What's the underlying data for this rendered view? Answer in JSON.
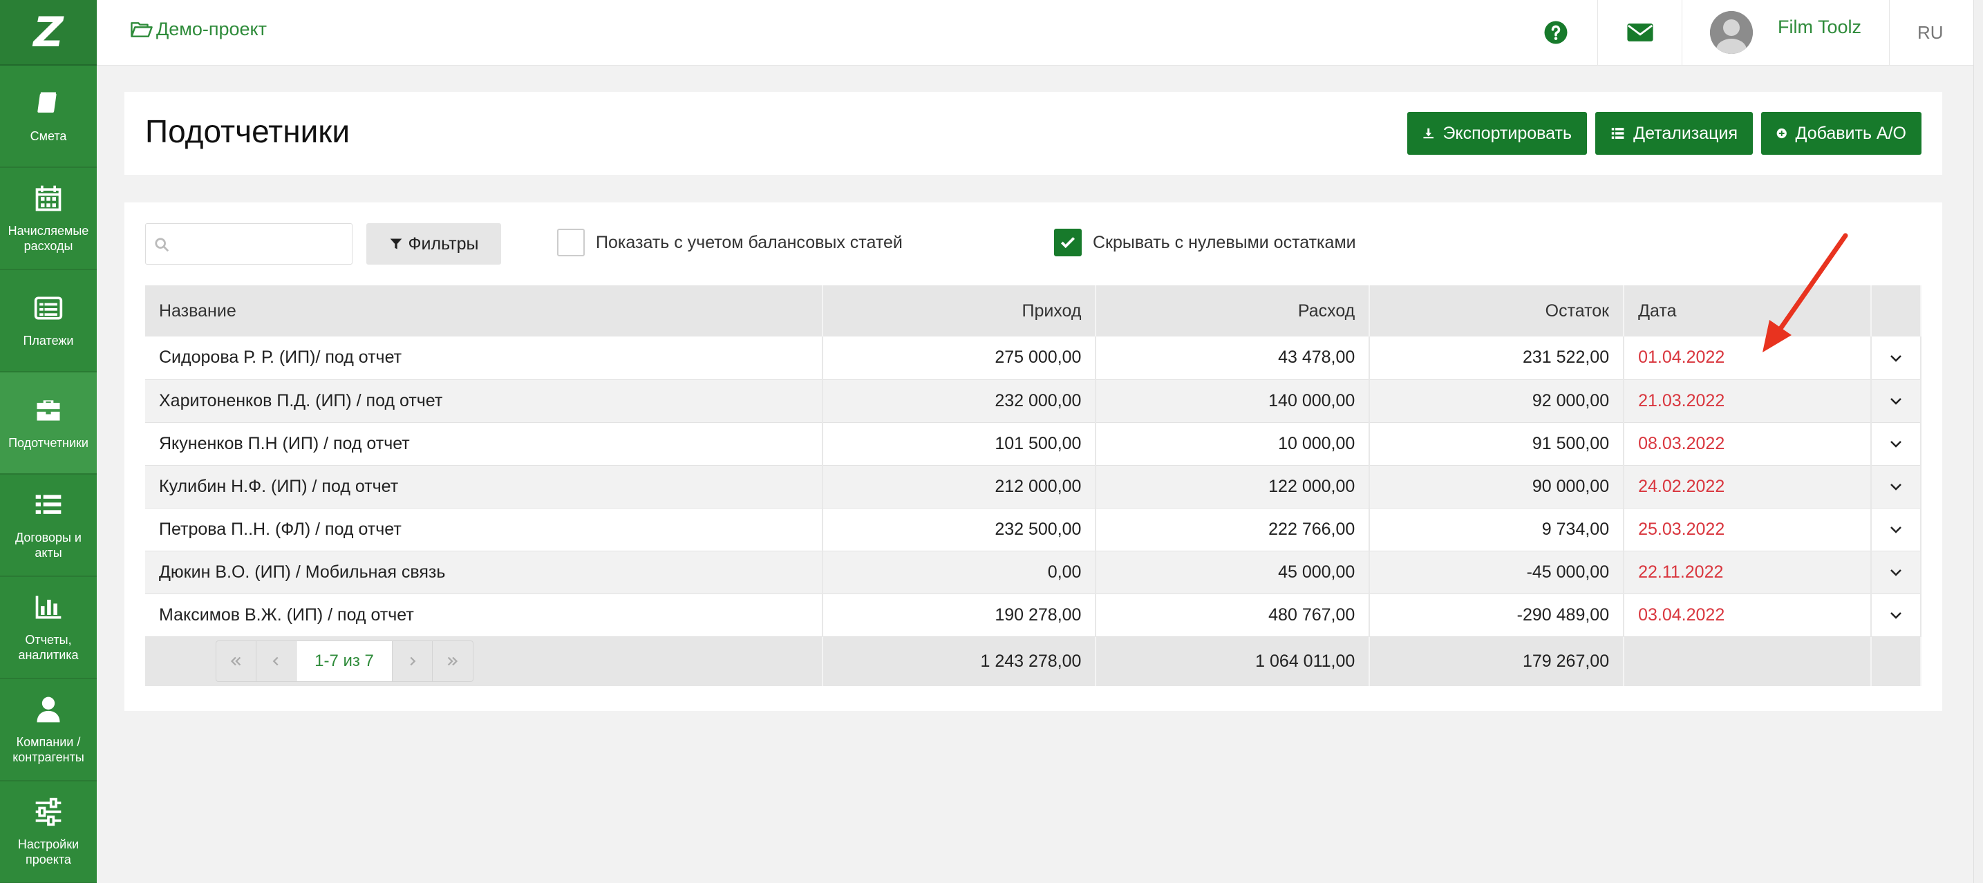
{
  "sidebar": {
    "logo": "Z",
    "items": [
      {
        "label": "Смета",
        "icon": "book-icon"
      },
      {
        "label": "Начисляемые расходы",
        "icon": "calendar-icon"
      },
      {
        "label": "Платежи",
        "icon": "list-window-icon"
      },
      {
        "label": "Подотчетники",
        "icon": "briefcase-icon",
        "active": true
      },
      {
        "label": "Договоры и акты",
        "icon": "list-icon"
      },
      {
        "label": "Отчеты, аналитика",
        "icon": "bar-chart-icon"
      },
      {
        "label": "Компании / контрагенты",
        "icon": "user-icon"
      },
      {
        "label": "Настройки проекта",
        "icon": "sliders-icon"
      }
    ]
  },
  "topbar": {
    "breadcrumb": "Демо-проект",
    "user_name": "Film Toolz",
    "language": "RU"
  },
  "page": {
    "title": "Подотчетники",
    "buttons": {
      "export": "Экспортировать",
      "details": "Детализация",
      "add": "Добавить А/О"
    }
  },
  "filters": {
    "search_value": "",
    "filter_button": "Фильтры",
    "checkbox_balance": {
      "label": "Показать с учетом балансовых статей",
      "checked": false
    },
    "checkbox_zero": {
      "label": "Скрывать с нулевыми остатками",
      "checked": true
    }
  },
  "table": {
    "columns": [
      "Название",
      "Приход",
      "Расход",
      "Остаток",
      "Дата"
    ],
    "rows": [
      {
        "name": "Сидорова Р. Р. (ИП)/ под отчет",
        "income": "275 000,00",
        "expense": "43 478,00",
        "balance": "231 522,00",
        "date": "01.04.2022"
      },
      {
        "name": "Харитоненков П.Д. (ИП) / под отчет",
        "income": "232 000,00",
        "expense": "140 000,00",
        "balance": "92 000,00",
        "date": "21.03.2022"
      },
      {
        "name": "Якуненков П.Н (ИП) / под отчет",
        "income": "101 500,00",
        "expense": "10 000,00",
        "balance": "91 500,00",
        "date": "08.03.2022"
      },
      {
        "name": "Кулибин Н.Ф. (ИП) / под отчет",
        "income": "212 000,00",
        "expense": "122 000,00",
        "balance": "90 000,00",
        "date": "24.02.2022"
      },
      {
        "name": "Петрова П..Н. (ФЛ) / под отчет",
        "income": "232 500,00",
        "expense": "222 766,00",
        "balance": "9 734,00",
        "date": "25.03.2022"
      },
      {
        "name": "Дюкин В.О. (ИП) / Мобильная связь",
        "income": "0,00",
        "expense": "45 000,00",
        "balance": "-45 000,00",
        "date": "22.11.2022"
      },
      {
        "name": "Максимов В.Ж. (ИП) / под отчет",
        "income": "190 278,00",
        "expense": "480 767,00",
        "balance": "-290 489,00",
        "date": "03.04.2022"
      }
    ],
    "totals": {
      "income": "1 243 278,00",
      "expense": "1 064 011,00",
      "balance": "179 267,00"
    },
    "pagination": "1-7 из 7"
  },
  "colors": {
    "sidebar": "#2f8a3a",
    "button": "#177a2b",
    "link": "#2e8b3a",
    "date": "#d9363e",
    "annotation_arrow": "#e8331f"
  }
}
